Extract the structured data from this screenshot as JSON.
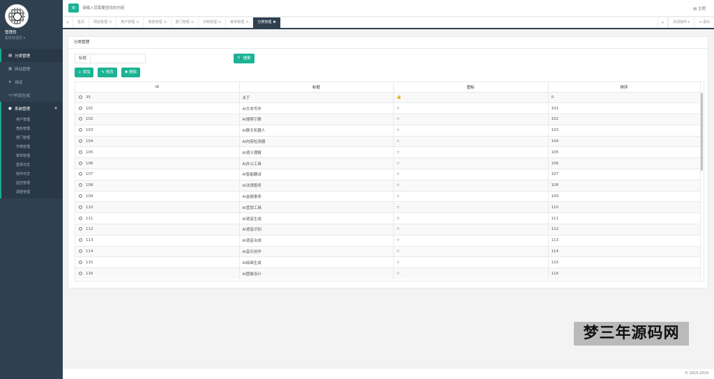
{
  "sidebar": {
    "user_name": "管理员",
    "user_role": "超级管理员 ▾",
    "items": [
      {
        "label": "分类管理",
        "icon": "list-icon"
      },
      {
        "label": "网站管理",
        "icon": "globe-icon"
      },
      {
        "label": "测试",
        "icon": "paper-plane-icon"
      },
      {
        "label": "代码生成",
        "icon": "code-icon"
      },
      {
        "label": "系统管理",
        "icon": "user-icon"
      }
    ],
    "subitems": [
      "用户管理",
      "角色管理",
      "部门管理",
      "字典管理",
      "菜单管理",
      "登录日志",
      "操作日志",
      "监控管理",
      "调度管理"
    ]
  },
  "header": {
    "search_placeholder": "请输入您需要查找的内容",
    "theme_label": "主题"
  },
  "tabs": {
    "items": [
      "首页",
      "网站管理",
      "用户管理",
      "角色管理",
      "部门管理",
      "字典管理",
      "菜单管理",
      "分类管理"
    ],
    "close_actions": "关闭操作",
    "exit": "退出"
  },
  "panel": {
    "title": "分类管理",
    "search_label": "标题",
    "search_button": "搜索",
    "add_button": "添加",
    "edit_button": "修改",
    "delete_button": "删除"
  },
  "table": {
    "headers": [
      "id",
      "标题",
      "图标",
      "排序"
    ],
    "rows": [
      {
        "id": "35",
        "title": "关于",
        "icon": "👍",
        "sort": "0"
      },
      {
        "id": "101",
        "title": "AI文本写作",
        "icon": "☆",
        "sort": "101"
      },
      {
        "id": "102",
        "title": "AI搜索引擎",
        "icon": "☆",
        "sort": "102"
      },
      {
        "id": "103",
        "title": "AI聊天机器人",
        "icon": "☆",
        "sort": "103"
      },
      {
        "id": "104",
        "title": "AI内容检测器",
        "icon": "☆",
        "sort": "104"
      },
      {
        "id": "105",
        "title": "AI语义理解",
        "icon": "☆",
        "sort": "105"
      },
      {
        "id": "106",
        "title": "AI办公工具",
        "icon": "☆",
        "sort": "106"
      },
      {
        "id": "107",
        "title": "AI智能翻译",
        "icon": "☆",
        "sort": "107"
      },
      {
        "id": "108",
        "title": "AI法律服务",
        "icon": "☆",
        "sort": "108"
      },
      {
        "id": "109",
        "title": "AI金融事务",
        "icon": "☆",
        "sort": "109"
      },
      {
        "id": "110",
        "title": "AI营销工具",
        "icon": "☆",
        "sort": "110"
      },
      {
        "id": "111",
        "title": "AI语音生成",
        "icon": "☆",
        "sort": "111"
      },
      {
        "id": "112",
        "title": "AI语音识别",
        "icon": "☆",
        "sort": "112"
      },
      {
        "id": "113",
        "title": "AI语音合成",
        "icon": "☆",
        "sort": "113"
      },
      {
        "id": "114",
        "title": "AI音乐创作",
        "icon": "☆",
        "sort": "114"
      },
      {
        "id": "115",
        "title": "AI绘画生成",
        "icon": "☆",
        "sort": "115"
      },
      {
        "id": "116",
        "title": "AI图像设计",
        "icon": "☆",
        "sort": "116"
      }
    ]
  },
  "watermark": "梦三年源码网",
  "footer": {
    "copyright": "© 2015-2019"
  },
  "colors": {
    "sidebar": "#2f4050",
    "accent": "#1ab394",
    "background": "#f3f3f4"
  }
}
